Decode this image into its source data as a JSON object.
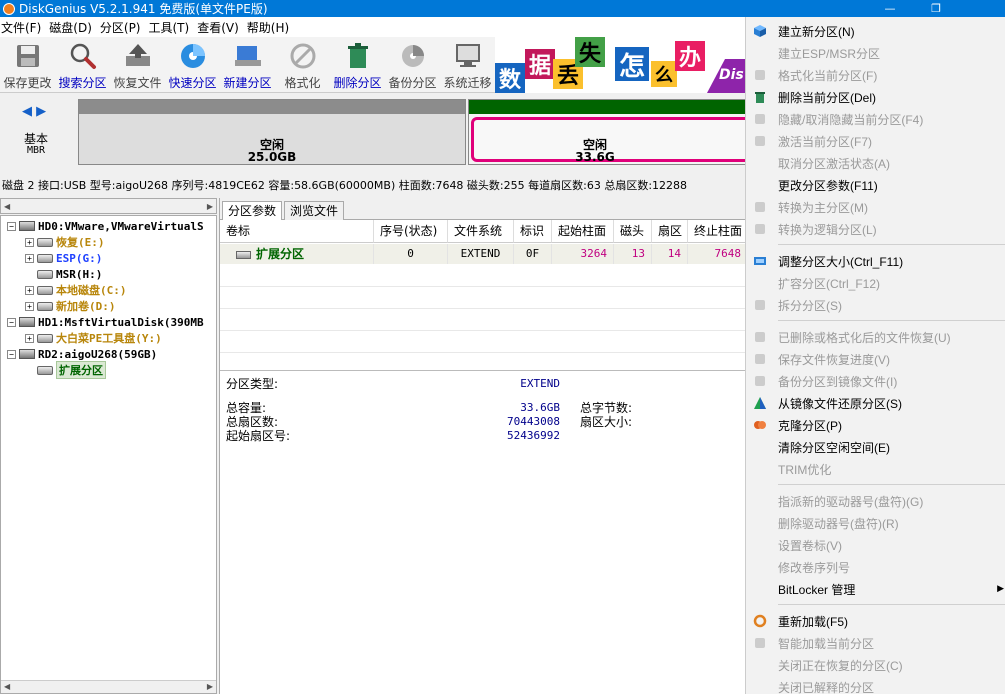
{
  "window": {
    "title": "DiskGenius V5.2.1.941 免费版(单文件PE版)",
    "buttons": [
      "—",
      "❐",
      ""
    ]
  },
  "menu": [
    "文件(F)",
    "磁盘(D)",
    "分区(P)",
    "工具(T)",
    "查看(V)",
    "帮助(H)"
  ],
  "toolbar": [
    {
      "label": "保存更改",
      "icon": "save-icon",
      "style": "gray"
    },
    {
      "label": "搜索分区",
      "icon": "search-icon",
      "style": "blue"
    },
    {
      "label": "恢复文件",
      "icon": "recover-icon",
      "style": "gray"
    },
    {
      "label": "快速分区",
      "icon": "disk-icon",
      "style": "blue"
    },
    {
      "label": "新建分区",
      "icon": "new-partition-icon",
      "style": "blue"
    },
    {
      "label": "格式化",
      "icon": "format-icon",
      "style": "gray"
    },
    {
      "label": "删除分区",
      "icon": "trash-icon",
      "style": "blue"
    },
    {
      "label": "备份分区",
      "icon": "backup-icon",
      "style": "gray"
    },
    {
      "label": "系统迁移",
      "icon": "migrate-icon",
      "style": "gray"
    }
  ],
  "banner": {
    "chars": [
      "数",
      "据",
      "丢",
      "失",
      "怎",
      "么",
      "办"
    ],
    "tail": "Dis"
  },
  "diskmap": {
    "nav": "◀ ▶",
    "type": "基本",
    "style": "MBR",
    "partitions": [
      {
        "name": "空闲",
        "size": "25.0GB"
      },
      {
        "name": "空闲",
        "size": "33.6G"
      }
    ]
  },
  "statusline": "磁盘 2 接口:USB  型号:aigoU268  序列号:4819CE62  容量:58.6GB(60000MB)  柱面数:7648  磁头数:255  每道扇区数:63  总扇区数:12288",
  "tree": {
    "nodes": [
      {
        "text": "HD0:VMware,VMwareVirtualS",
        "color": "#000",
        "exp": "−",
        "icon": "hd"
      },
      {
        "text": "恢复(E:)",
        "color": "#b8860b",
        "exp": "+",
        "icon": "part"
      },
      {
        "text": "ESP(G:)",
        "color": "#1e40ff",
        "exp": "+",
        "icon": "part"
      },
      {
        "text": "MSR(H:)",
        "color": "#000",
        "exp": "",
        "icon": "part"
      },
      {
        "text": "本地磁盘(C:)",
        "color": "#b8860b",
        "exp": "+",
        "icon": "part"
      },
      {
        "text": "新加卷(D:)",
        "color": "#b8860b",
        "exp": "+",
        "icon": "part"
      },
      {
        "text": "HD1:MsftVirtualDisk(390MB",
        "color": "#000",
        "exp": "−",
        "icon": "hd"
      },
      {
        "text": "大白菜PE工具盘(Y:)",
        "color": "#b8860b",
        "exp": "+",
        "icon": "part"
      },
      {
        "text": "RD2:aigoU268(59GB)",
        "color": "#000",
        "exp": "−",
        "icon": "hd"
      },
      {
        "text": "扩展分区",
        "color": "#006400",
        "exp": "",
        "icon": "part"
      }
    ]
  },
  "tabs": [
    "分区参数",
    "浏览文件"
  ],
  "table": {
    "headers": [
      "卷标",
      "序号(状态)",
      "文件系统",
      "标识",
      "起始柱面",
      "磁头",
      "扇区",
      "终止柱面"
    ],
    "row": [
      "扩展分区",
      "0",
      "EXTEND",
      "0F",
      "3264",
      "13",
      "14",
      "7648"
    ]
  },
  "details": {
    "type_label": "分区类型:",
    "type_value": "EXTEND",
    "capacity_label": "总容量:",
    "capacity_value": "33.6GB",
    "sectors_label": "总扇区数:",
    "sectors_value": "70443008",
    "start_label": "起始扇区号:",
    "start_value": "52436992",
    "bytes_label": "总字节数:",
    "sector_size_label": "扇区大小:"
  },
  "context_menu": [
    {
      "label": "建立新分区(N)",
      "enabled": true,
      "icon": "cube-icon",
      "color": "#2a7fd4"
    },
    {
      "label": "建立ESP/MSR分区",
      "enabled": false,
      "icon": "",
      "color": ""
    },
    {
      "label": "格式化当前分区(F)",
      "enabled": false,
      "icon": "format-icon",
      "color": "#ccc"
    },
    {
      "label": "删除当前分区(Del)",
      "enabled": true,
      "icon": "trash-icon",
      "color": "#2e8b57"
    },
    {
      "label": "隐藏/取消隐藏当前分区(F4)",
      "enabled": false,
      "icon": "hide-icon",
      "color": "#ccc"
    },
    {
      "label": "激活当前分区(F7)",
      "enabled": false,
      "icon": "activate-icon",
      "color": "#ccc"
    },
    {
      "label": "取消分区激活状态(A)",
      "enabled": false,
      "icon": "",
      "color": ""
    },
    {
      "label": "更改分区参数(F11)",
      "enabled": true,
      "icon": "",
      "color": ""
    },
    {
      "label": "转换为主分区(M)",
      "enabled": false,
      "icon": "convert-icon",
      "color": "#ccc"
    },
    {
      "label": "转换为逻辑分区(L)",
      "enabled": false,
      "icon": "convert-icon",
      "color": "#ccc"
    },
    {
      "sep": true
    },
    {
      "label": "调整分区大小(Ctrl_F11)",
      "enabled": true,
      "icon": "resize-icon",
      "color": "#2a7fd4"
    },
    {
      "label": "扩容分区(Ctrl_F12)",
      "enabled": false,
      "icon": "",
      "color": ""
    },
    {
      "label": "拆分分区(S)",
      "enabled": false,
      "icon": "split-icon",
      "color": "#ccc"
    },
    {
      "sep": true
    },
    {
      "label": "已删除或格式化后的文件恢复(U)",
      "enabled": false,
      "icon": "recover-icon",
      "color": "#ccc"
    },
    {
      "label": "保存文件恢复进度(V)",
      "enabled": false,
      "icon": "save-icon",
      "color": "#ccc"
    },
    {
      "label": "备份分区到镜像文件(I)",
      "enabled": false,
      "icon": "backup-icon",
      "color": "#ccc"
    },
    {
      "label": "从镜像文件还原分区(S)",
      "enabled": true,
      "icon": "restore-icon",
      "color": "#20a050"
    },
    {
      "label": "克隆分区(P)",
      "enabled": true,
      "icon": "clone-icon",
      "color": "#e06020"
    },
    {
      "label": "清除分区空闲空间(E)",
      "enabled": true,
      "icon": "",
      "color": ""
    },
    {
      "label": "TRIM优化",
      "enabled": false,
      "icon": "",
      "color": ""
    },
    {
      "sep": true
    },
    {
      "label": "指派新的驱动器号(盘符)(G)",
      "enabled": false,
      "icon": "",
      "color": ""
    },
    {
      "label": "删除驱动器号(盘符)(R)",
      "enabled": false,
      "icon": "",
      "color": ""
    },
    {
      "label": "设置卷标(V)",
      "enabled": false,
      "icon": "",
      "color": ""
    },
    {
      "label": "修改卷序列号",
      "enabled": false,
      "icon": "",
      "color": ""
    },
    {
      "label": "BitLocker 管理",
      "enabled": true,
      "icon": "",
      "color": "",
      "submenu": true
    },
    {
      "sep": true
    },
    {
      "label": "重新加载(F5)",
      "enabled": true,
      "icon": "reload-icon",
      "color": "#e08020"
    },
    {
      "label": "智能加载当前分区",
      "enabled": false,
      "icon": "smart-load-icon",
      "color": "#ccc"
    },
    {
      "label": "关闭正在恢复的分区(C)",
      "enabled": false,
      "icon": "",
      "color": ""
    },
    {
      "label": "关闭已解释的分区",
      "enabled": false,
      "icon": "",
      "color": ""
    }
  ]
}
